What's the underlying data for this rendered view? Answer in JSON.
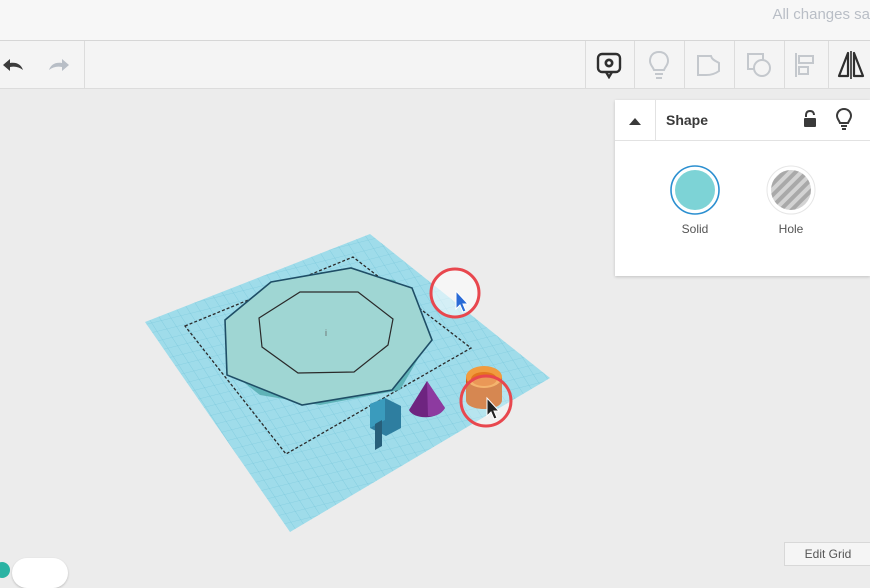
{
  "header": {
    "save_status": "All changes sa"
  },
  "toolbar": {
    "undo_icon": "undo-icon",
    "redo_icon": "redo-icon",
    "tools": [
      "notes-icon",
      "show-all-icon",
      "group-icon",
      "ungroup-icon",
      "align-icon",
      "mirror-icon"
    ]
  },
  "shape_panel": {
    "title": "Shape",
    "options": [
      {
        "label": "Solid",
        "color": "#7dd3d6"
      },
      {
        "label": "Hole",
        "color": "#bdbdbd"
      }
    ],
    "icons": [
      "collapse-icon",
      "lock-icon",
      "light-bulb-icon"
    ]
  },
  "workplane": {
    "grid_color": "#8fd3e4",
    "shapes": [
      {
        "name": "octagon-base",
        "color": "#8fd0cf"
      },
      {
        "name": "blue-block",
        "color": "#2c7c9c"
      },
      {
        "name": "purple-cone",
        "color": "#7b2c8c"
      },
      {
        "name": "orange-cylinder",
        "color": "#e07a22"
      }
    ]
  },
  "footer": {
    "edit_grid_label": "Edit Grid"
  }
}
